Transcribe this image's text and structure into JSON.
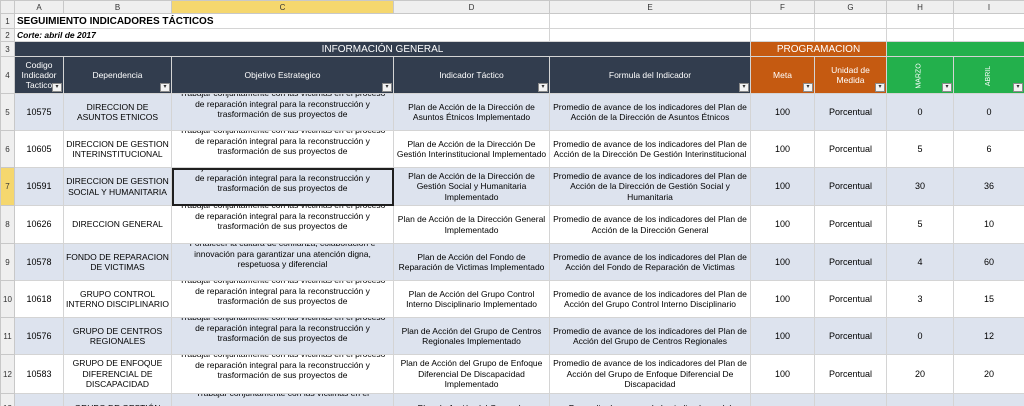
{
  "columns": [
    "A",
    "B",
    "C",
    "D",
    "E",
    "F",
    "G",
    "H",
    "I"
  ],
  "selected_column": "C",
  "selected_row": "7",
  "title": "SEGUIMIENTO INDICADORES TÁCTICOS",
  "subtitle": "Corte: abril de 2017",
  "bands": {
    "info": "INFORMACIÓN GENERAL",
    "programacion": "PROGRAMACION"
  },
  "headers": {
    "codigo": "Codigo Indicador Tactico",
    "dependencia": "Dependencia",
    "objetivo": "Objetivo Estrategico",
    "indicador": "Indicador Táctico",
    "formula": "Formula del Indicador",
    "meta": "Meta",
    "unidad": "Unidad de Medida",
    "marzo": "MARZO",
    "abril": "ABRIL"
  },
  "filter_glyph": "▾",
  "colors": {
    "info_band": "#323d4e",
    "programacion_band": "#c55a11",
    "months_band": "#23b04c",
    "banded_row": "#dde3ee"
  },
  "rows": [
    {
      "row": "5",
      "codigo": "10575",
      "dependencia": "DIRECCION DE ASUNTOS ETNICOS",
      "objetivo": "Trabajar conjuntamente con las víctimas en el proceso de reparación integral para la reconstrucción y trasformación de sus proyectos de",
      "indicador": "Plan de Acción de la Dirección de Asuntos Étnicos Implementado",
      "formula": "Promedio de avance de los indicadores del Plan de Acción de la Dirección de Asuntos Étnicos",
      "meta": "100",
      "unidad": "Porcentual",
      "marzo": "0",
      "abril": "0"
    },
    {
      "row": "6",
      "codigo": "10605",
      "dependencia": "DIRECCION DE GESTION INTERINSTITUCIONAL",
      "objetivo": "Trabajar conjuntamente con las víctimas en el proceso de reparación integral para la reconstrucción y trasformación de sus proyectos de",
      "indicador": "Plan de Acción de la Dirección De Gestión Interinstitucional Implementado",
      "formula": "Promedio de avance de los indicadores del Plan de Acción de la Dirección De Gestión Interinstitucional",
      "meta": "100",
      "unidad": "Porcentual",
      "marzo": "5",
      "abril": "6"
    },
    {
      "row": "7",
      "codigo": "10591",
      "dependencia": "DIRECCION DE GESTION SOCIAL Y HUMANITARIA",
      "objetivo": "Trabajar conjuntamente con las víctimas en el proceso de reparación integral para la reconstrucción y trasformación de sus proyectos de",
      "indicador": "Plan de Acción de la Dirección de Gestión Social y Humanitaria Implementado",
      "formula": "Promedio de avance de los indicadores del Plan de Acción de la Dirección de Gestión Social y Humanitaria",
      "meta": "100",
      "unidad": "Porcentual",
      "marzo": "30",
      "abril": "36"
    },
    {
      "row": "8",
      "codigo": "10626",
      "dependencia": "DIRECCION GENERAL",
      "objetivo": "Trabajar conjuntamente con las víctimas en el proceso de reparación integral para la reconstrucción y trasformación de sus proyectos de",
      "indicador": "Plan de Acción de la Dirección General Implementado",
      "formula": "Promedio de avance de los indicadores del Plan de Acción de la Dirección General",
      "meta": "100",
      "unidad": "Porcentual",
      "marzo": "5",
      "abril": "10"
    },
    {
      "row": "9",
      "codigo": "10578",
      "dependencia": "FONDO DE REPARACION DE VICTIMAS",
      "objetivo": "Fortalecer la cultura de confianza, colaboración e innovación para garantizar una atención digna, respetuosa y diferencial",
      "indicador": "Plan de Acción del Fondo de Reparación de Victimas Implementado",
      "formula": "Promedio de avance de los indicadores del Plan de Acción del Fondo de Reparación de Victimas",
      "meta": "100",
      "unidad": "Porcentual",
      "marzo": "4",
      "abril": "60"
    },
    {
      "row": "10",
      "codigo": "10618",
      "dependencia": "GRUPO CONTROL INTERNO DISCIPLINARIO",
      "objetivo": "Trabajar conjuntamente con las víctimas en el proceso de reparación integral para la reconstrucción y trasformación de sus proyectos de",
      "indicador": "Plan de Acción del Grupo Control Interno Disciplinario Implementado",
      "formula": "Promedio de avance de los indicadores del Plan de Acción del Grupo Control Interno Disciplinario",
      "meta": "100",
      "unidad": "Porcentual",
      "marzo": "3",
      "abril": "15"
    },
    {
      "row": "11",
      "codigo": "10576",
      "dependencia": "GRUPO DE CENTROS REGIONALES",
      "objetivo": "Trabajar conjuntamente con las víctimas en el proceso de reparación integral para la reconstrucción y trasformación de sus proyectos de",
      "indicador": "Plan de Acción del Grupo de Centros Regionales Implementado",
      "formula": "Promedio de avance de los indicadores del Plan de Acción del Grupo de Centros Regionales",
      "meta": "100",
      "unidad": "Porcentual",
      "marzo": "0",
      "abril": "12"
    },
    {
      "row": "12",
      "codigo": "10583",
      "dependencia": "GRUPO DE ENFOQUE DIFERENCIAL DE DISCAPACIDAD",
      "objetivo": "Trabajar conjuntamente con las víctimas en el proceso de reparación integral para la reconstrucción y trasformación de sus proyectos de",
      "indicador": "Plan de Acción del Grupo de Enfoque Diferencial De Discapacidad Implementado",
      "formula": "Promedio de avance de los indicadores del Plan de Acción del Grupo de Enfoque Diferencial De Discapacidad",
      "meta": "100",
      "unidad": "Porcentual",
      "marzo": "20",
      "abril": "20"
    },
    {
      "row": "13",
      "codigo": "",
      "dependencia": "GRUPO DE GESTIÓN",
      "objetivo": "Trabajar conjuntamente con las víctimas en el",
      "indicador": "Plan de Acción del Grupo de",
      "formula": "Promedio de avance de los indicadores del",
      "meta": "",
      "unidad": "",
      "marzo": "",
      "abril": ""
    }
  ]
}
